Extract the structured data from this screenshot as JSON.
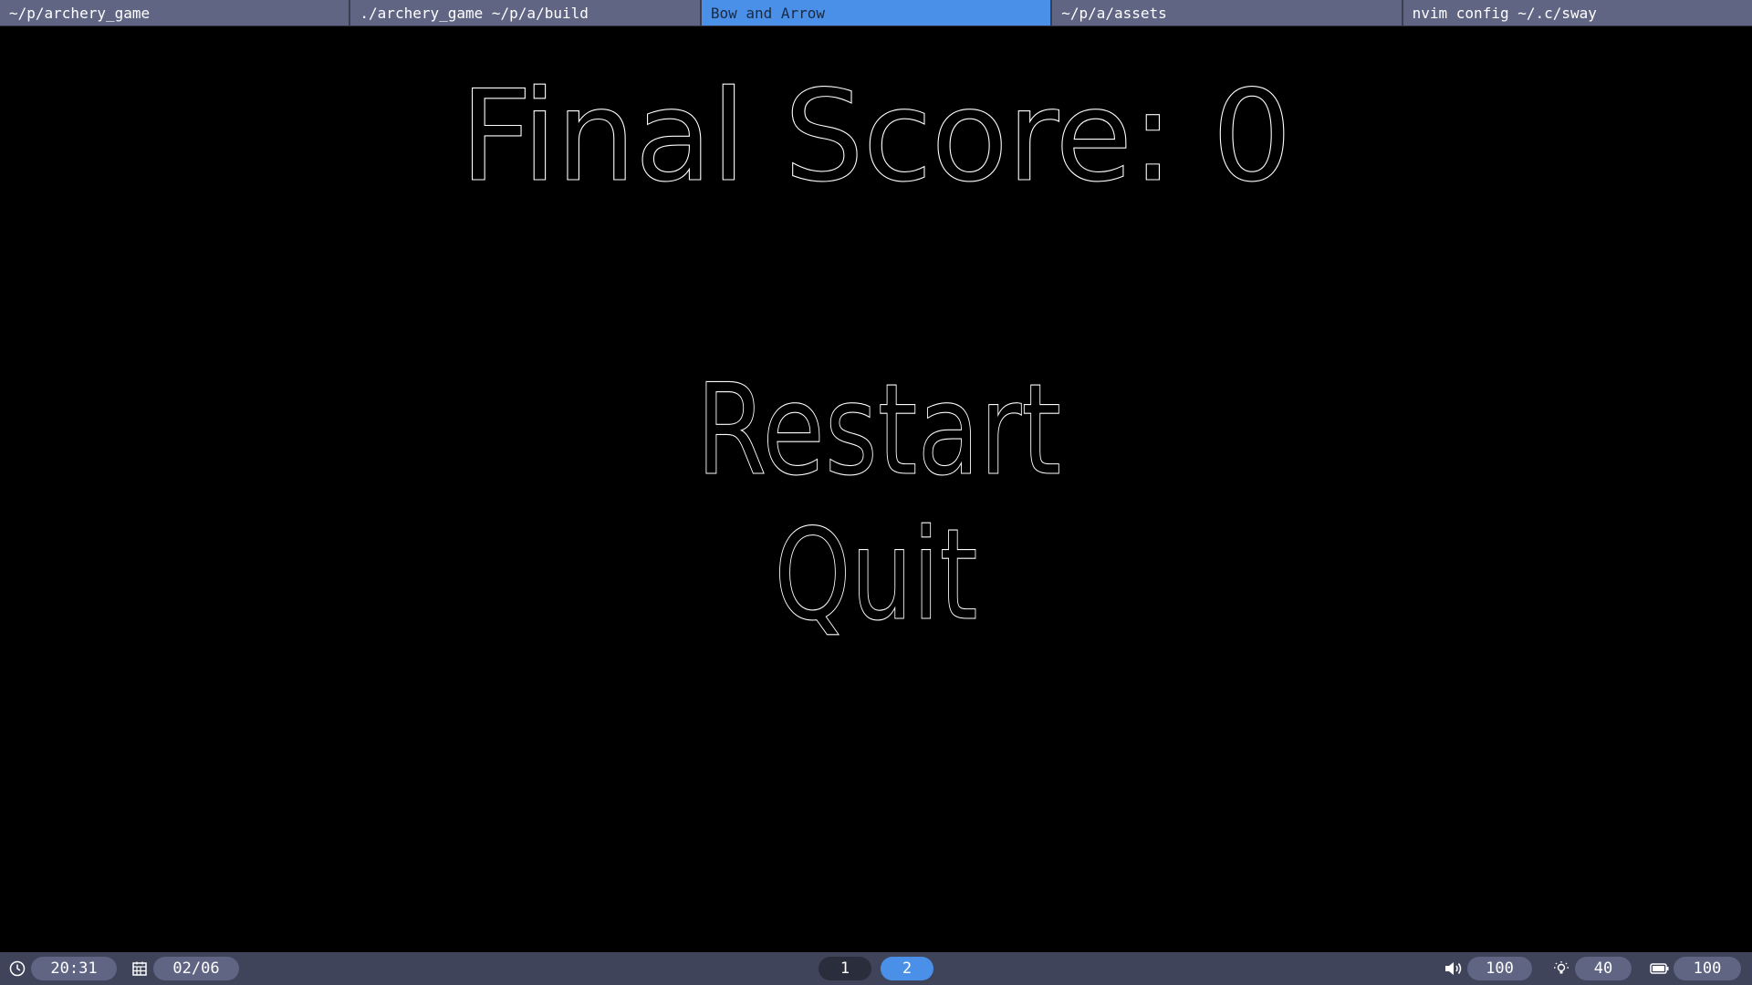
{
  "tabs": [
    {
      "label": "~/p/archery_game",
      "active": false
    },
    {
      "label": "./archery_game ~/p/a/build",
      "active": false
    },
    {
      "label": "Bow and Arrow",
      "active": true
    },
    {
      "label": "~/p/a/assets",
      "active": false
    },
    {
      "label": "nvim config ~/.c/sway",
      "active": false
    }
  ],
  "game": {
    "score_text": "Final Score: 0",
    "menu": {
      "restart_label": "Restart",
      "quit_label": "Quit"
    }
  },
  "statusbar": {
    "clock": {
      "icon": "clock-icon",
      "value": "20:31"
    },
    "date": {
      "icon": "calendar-icon",
      "value": "02/06"
    },
    "workspaces": [
      {
        "label": "1",
        "active": false
      },
      {
        "label": "2",
        "active": true
      }
    ],
    "volume": {
      "icon": "speaker-icon",
      "value": "100"
    },
    "brightness": {
      "icon": "lightbulb-icon",
      "value": "40"
    },
    "battery": {
      "icon": "battery-icon",
      "value": "100"
    }
  },
  "colors": {
    "accent": "#4a90e8",
    "bar_background": "#3f445a",
    "tab_background": "#5f6583",
    "game_background": "#000000",
    "outline_text": "#ffffff"
  }
}
